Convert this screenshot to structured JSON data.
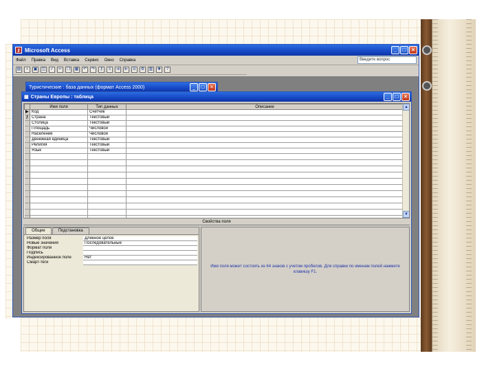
{
  "app": {
    "title": "Microsoft Access",
    "help_box": "Введите вопрос",
    "menu": [
      "Файл",
      "Правка",
      "Вид",
      "Вставка",
      "Сервис",
      "Окно",
      "Справка"
    ]
  },
  "toolbar": {
    "icons": [
      "view-icon",
      "save-icon",
      "print-icon",
      "preview-icon",
      "spell-icon",
      "cut-icon",
      "copy-icon",
      "paste-icon",
      "undo-icon",
      "redo-icon",
      "key-icon",
      "indexes-icon",
      "insert-row-icon",
      "delete-row-icon",
      "properties-icon",
      "build-icon",
      "database-window-icon",
      "new-object-icon",
      "help-icon"
    ],
    "glyphs": [
      "▤",
      "▪",
      "▣",
      "◫",
      "✓",
      "✂",
      "❐",
      "▦",
      "↶",
      "↷",
      "⚷",
      "≡",
      "⇉",
      "⇇",
      "☰",
      "⚙",
      "▥",
      "✚",
      "?"
    ]
  },
  "db_window": {
    "title": "Туристические : база данных (формат Access 2000)"
  },
  "table_window": {
    "title": "Страны Европы : таблица",
    "columns": [
      "Имя поля",
      "Тип данных",
      "Описание"
    ],
    "fields": [
      {
        "marker": "▶",
        "name": "Код",
        "type": "Счетчик"
      },
      {
        "marker": "⚷",
        "name": "Страна",
        "type": "Текстовый"
      },
      {
        "marker": "",
        "name": "Столица",
        "type": "Текстовый"
      },
      {
        "marker": "",
        "name": "Площадь",
        "type": "Числовой"
      },
      {
        "marker": "",
        "name": "Население",
        "type": "Числовой"
      },
      {
        "marker": "",
        "name": "Денежная единица",
        "type": "Текстовый"
      },
      {
        "marker": "",
        "name": "Религия",
        "type": "Текстовый"
      },
      {
        "marker": "",
        "name": "Язык",
        "type": "Текстовый"
      }
    ],
    "blank_rows": 11,
    "props_header": "Свойства поля",
    "tabs": [
      "Общие",
      "Подстановка"
    ],
    "properties": [
      {
        "label": "Размер поля",
        "value": "Длинное целое"
      },
      {
        "label": "Новые значения",
        "value": "Последовательные"
      },
      {
        "label": "Формат поля",
        "value": ""
      },
      {
        "label": "Подпись",
        "value": ""
      },
      {
        "label": "Индексированное поле",
        "value": "Нет"
      },
      {
        "label": "Смарт-теги",
        "value": ""
      }
    ],
    "hint": "Имя поля может состоять из 64 знаков с учетом пробелов. Для справки по именам полей нажмите клавишу F1."
  },
  "colors": {
    "titlebar": "#1747c5",
    "window_bg": "#d4d0c8",
    "hint_text": "#1f34a8"
  }
}
